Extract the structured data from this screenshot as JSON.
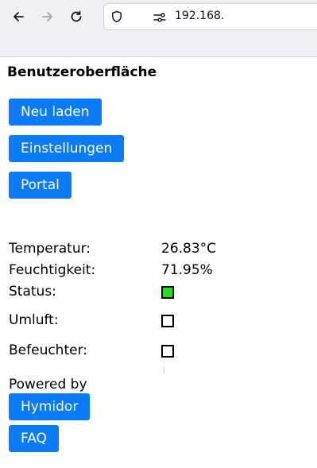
{
  "browser": {
    "url": "192.168."
  },
  "page": {
    "title": "Benutzeroberfläche",
    "buttons": {
      "reload": "Neu laden",
      "settings": "Einstellungen",
      "portal": "Portal",
      "hymidor": "Hymidor",
      "faq": "FAQ"
    },
    "readings": {
      "temperature_label": "Temperatur:",
      "temperature_value": "26.83°C",
      "humidity_label": "Feuchtigkeit:",
      "humidity_value": "71.95%",
      "status_label": "Status:",
      "status_state": true,
      "status_color": "#22dd22",
      "circulation_label": "Umluft:",
      "circulation_state": false,
      "humidifier_label": "Befeuchter:",
      "humidifier_state": false
    },
    "powered_by": "Powered by"
  },
  "colors": {
    "button_bg": "#0b7cf5",
    "toolbar_bg": "#f0f0f4"
  }
}
